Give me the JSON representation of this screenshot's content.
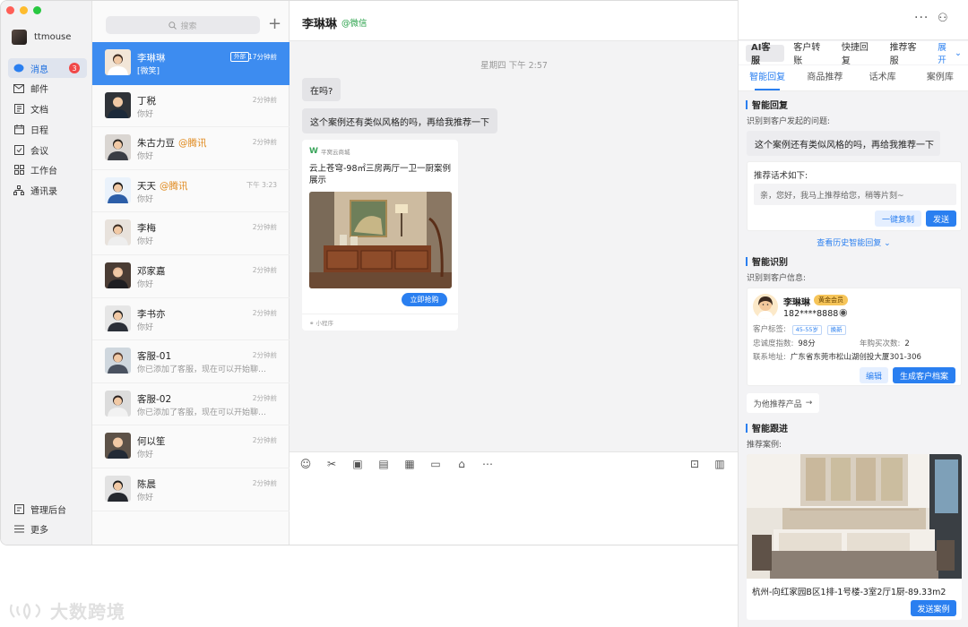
{
  "nav": {
    "username": "ttmouse",
    "items": [
      {
        "label": "消息",
        "badge": "3"
      },
      {
        "label": "邮件"
      },
      {
        "label": "文档"
      },
      {
        "label": "日程"
      },
      {
        "label": "会议"
      },
      {
        "label": "工作台"
      },
      {
        "label": "通讯录"
      }
    ],
    "bottom": [
      {
        "label": "管理后台"
      },
      {
        "label": "更多"
      }
    ]
  },
  "list": {
    "search_placeholder": "搜索",
    "items": [
      {
        "name": "李琳琳",
        "tag": "外部",
        "time": "17分钟前",
        "msg": "[微笑]"
      },
      {
        "name": "丁税",
        "org": "",
        "time": "2分钟前",
        "msg": "你好"
      },
      {
        "name": "朱古力豆",
        "org": "@腾讯",
        "time": "2分钟前",
        "msg": "你好"
      },
      {
        "name": "天天",
        "org": "@腾讯",
        "time": "下午 3:23",
        "msg": "你好"
      },
      {
        "name": "李梅",
        "org": "",
        "time": "2分钟前",
        "msg": "你好"
      },
      {
        "name": "邓家嘉",
        "org": "",
        "time": "2分钟前",
        "msg": "你好"
      },
      {
        "name": "李书亦",
        "org": "",
        "time": "2分钟前",
        "msg": "你好"
      },
      {
        "name": "客服-01",
        "org": "",
        "time": "2分钟前",
        "msg": "你已添加了客服，现在可以开始聊天了。"
      },
      {
        "name": "客服-02",
        "org": "",
        "time": "2分钟前",
        "msg": "你已添加了客服，现在可以开始聊天了。"
      },
      {
        "name": "何以笙",
        "org": "",
        "time": "2分钟前",
        "msg": "你好"
      },
      {
        "name": "陈晨",
        "org": "",
        "time": "2分钟前",
        "msg": "你好"
      }
    ]
  },
  "chat": {
    "title": "李琳琳",
    "source": "@微信",
    "date": "星期四  下午 2:57",
    "messages": [
      "在吗?",
      "这个案例还有类似风格的吗，再给我推荐一下"
    ],
    "card": {
      "brand": "平窝云商城",
      "title": "云上苍穹-98㎡三房两厅一卫一厨案例展示",
      "button": "立即抢购",
      "footer": "小程序"
    }
  },
  "ai": {
    "tabs": [
      "AI客服",
      "客户转账",
      "快捷回复",
      "推荐客服"
    ],
    "expand": "展开",
    "sub_tabs": [
      "智能回复",
      "商品推荐",
      "话术库",
      "案例库"
    ],
    "reply": {
      "title": "智能回复",
      "label": "识别到客户发起的问题:",
      "question": "这个案例还有类似风格的吗，再给我推荐一下",
      "suggest_label": "推荐话术如下:",
      "suggest_text": "亲，您好，我马上推荐给您，稍等片刻~",
      "copy_btn": "一键复制",
      "send_btn": "发送",
      "history": "查看历史智能回复"
    },
    "identify": {
      "title": "智能识别",
      "label": "识别到客户信息:",
      "name": "李琳琳",
      "vip": "黄金会员",
      "phone": "182****8888",
      "tag_label": "客户标签:",
      "tags": [
        "45-55岁",
        "换新"
      ],
      "loyalty_label": "忠诚度指数:",
      "loyalty": "98分",
      "yearly_label": "年购买次数:",
      "yearly": "2",
      "addr_label": "联系地址:",
      "addr": "广东省东莞市松山湖创投大厦301-306",
      "edit_btn": "编辑",
      "profile_btn": "生成客户档案",
      "rec_btn": "为他推荐产品"
    },
    "follow": {
      "title": "智能跟进",
      "label": "推荐案例:",
      "case_title": "杭州-向红家园B区1排-1号楼-3室2厅1厨-89.33m2",
      "send_btn": "发送案例"
    }
  },
  "watermark": "大数跨境",
  "colors": {
    "accent": "#2a7ff0",
    "selected": "#3d8cf0",
    "badge": "#f04848",
    "vip": "#f6c55a",
    "wechat": "#2aa24b",
    "org": "#e08a1e"
  }
}
